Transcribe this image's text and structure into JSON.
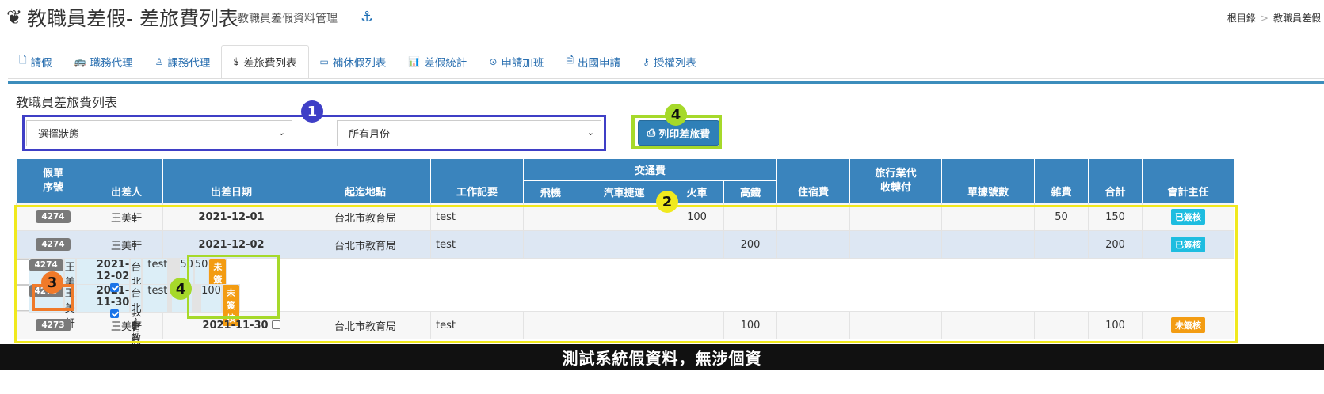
{
  "header": {
    "title": "教職員差假- 差旅費列表",
    "subtitle": "教職員差假資料管理",
    "breadcrumb": [
      "根目錄",
      "教職員差假"
    ]
  },
  "tabs": [
    {
      "label": "請假",
      "icon": "file-icon",
      "active": false
    },
    {
      "label": "職務代理",
      "icon": "bus-icon",
      "active": false
    },
    {
      "label": "課務代理",
      "icon": "person-icon",
      "active": false
    },
    {
      "label": "差旅費列表",
      "icon": "dollar-icon",
      "active": true
    },
    {
      "label": "補休假列表",
      "icon": "card-icon",
      "active": false
    },
    {
      "label": "差假統計",
      "icon": "bar-chart-icon",
      "active": false
    },
    {
      "label": "申請加班",
      "icon": "clock-icon",
      "active": false
    },
    {
      "label": "出國申請",
      "icon": "document-icon",
      "active": false
    },
    {
      "label": "授權列表",
      "icon": "key-icon",
      "active": false
    }
  ],
  "panel": {
    "title": "教職員差旅費列表"
  },
  "filters": {
    "status": "選擇狀態",
    "month": "所有月份"
  },
  "print_button": "列印差旅費",
  "table": {
    "headers": {
      "id": "假單\n序號",
      "traveler": "出差人",
      "date": "出差日期",
      "place": "起迄地點",
      "work": "工作記要",
      "transport": "交通費",
      "plane": "飛機",
      "bus": "汽車捷運",
      "train": "火車",
      "hsr": "高鐵",
      "lodging": "住宿費",
      "agency": "旅行業代\n收轉付",
      "receipts": "單據號數",
      "misc": "雜費",
      "total": "合計",
      "accounting": "會計主任"
    },
    "rows": [
      {
        "id": "4274",
        "name": "王美軒",
        "date": "2021-12-01",
        "checkbox": null,
        "place": "台北市教育局",
        "work": "test",
        "plane": "",
        "bus": "",
        "train": "100",
        "hsr": "",
        "lodging": "",
        "agency": "",
        "receipts": "",
        "misc": "50",
        "total": "150",
        "status": "已簽核",
        "status_type": "ok"
      },
      {
        "id": "4274",
        "name": "王美軒",
        "date": "2021-12-02",
        "checkbox": null,
        "place": "台北市教育局",
        "work": "test",
        "plane": "",
        "bus": "",
        "train": "",
        "hsr": "200",
        "lodging": "",
        "agency": "",
        "receipts": "",
        "misc": "",
        "total": "200",
        "status": "已簽核",
        "status_type": "ok"
      },
      {
        "id": "4274",
        "name": "王美軒",
        "date": "2021-12-02",
        "checkbox": true,
        "place": "台北市教育局",
        "work": "test",
        "plane": "",
        "bus": "",
        "train": "",
        "hsr": "",
        "lodging": "",
        "agency": "",
        "receipts": "",
        "misc": "50",
        "total": "50",
        "status": "未簽核",
        "status_type": "no"
      },
      {
        "id": "4273",
        "name": "王美軒",
        "date": "2021-11-30",
        "checkbox": true,
        "place": "台北市教育局",
        "work": "test",
        "plane": "",
        "bus": "",
        "train": "100",
        "hsr": "",
        "lodging": "",
        "agency": "",
        "receipts": "",
        "misc": "",
        "total": "100",
        "status": "未簽核",
        "status_type": "no"
      },
      {
        "id": "4273",
        "name": "王美軒",
        "date": "2021-11-30",
        "checkbox": false,
        "place": "台北市教育局",
        "work": "test",
        "plane": "",
        "bus": "",
        "train": "",
        "hsr": "100",
        "lodging": "",
        "agency": "",
        "receipts": "",
        "misc": "",
        "total": "100",
        "status": "未簽核",
        "status_type": "no"
      }
    ]
  },
  "annotations": {
    "m1": "1",
    "m2": "2",
    "m3": "3",
    "m4": "4"
  },
  "footer": "測試系統假資料，無涉個資",
  "colors": {
    "primary": "#3a84bd",
    "signed": "#1ebde0",
    "unsigned": "#f39c12"
  }
}
